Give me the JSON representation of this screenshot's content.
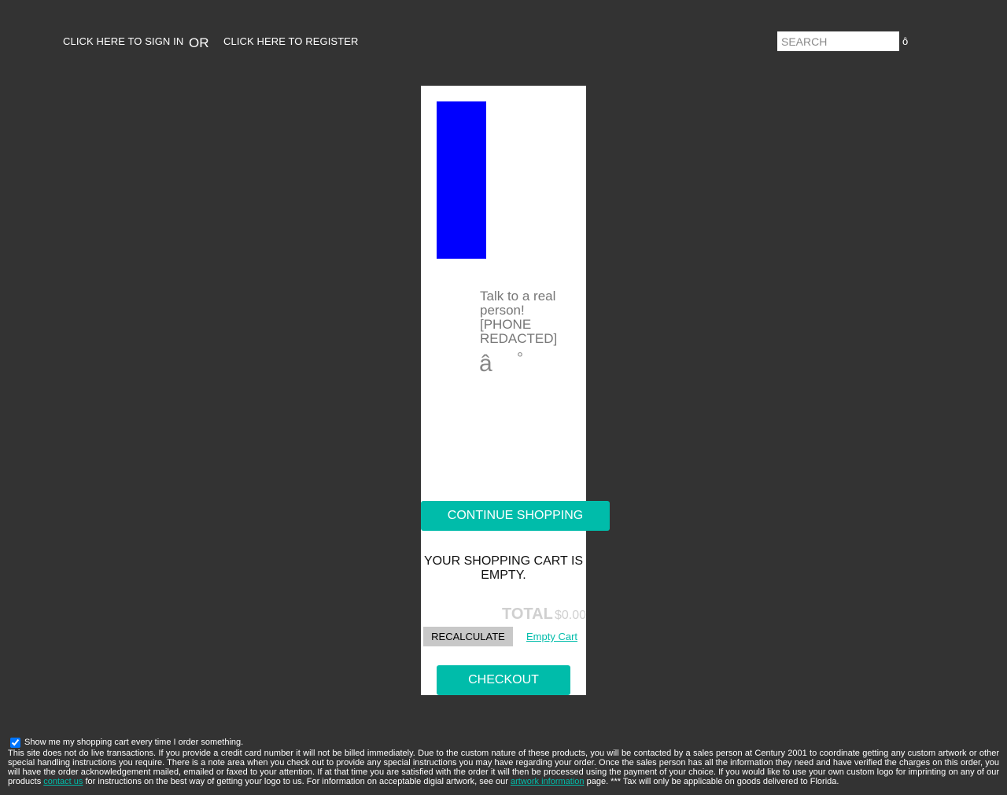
{
  "header": {
    "signin_label": "CLICK HERE TO SIGN IN",
    "or_label": "OR",
    "register_label": "CLICK HERE TO REGISTER",
    "search_placeholder": "SEARCH",
    "search_icon_glyph": "ȏ"
  },
  "cart": {
    "talk_text": "Talk to a real person! [PHONE REDACTED]",
    "glyph_a": "â",
    "glyph_degree": "°",
    "continue_label": "CONTINUE SHOPPING",
    "empty_message": "YOUR SHOPPING CART IS EMPTY.",
    "total_label": "TOTAL",
    "total_value": "$0.00",
    "recalculate_label": "RECALCULATE",
    "empty_cart_label": "Empty Cart",
    "checkout_label": "CHECKOUT"
  },
  "footer": {
    "show_cart_label": "Show me my shopping cart every time I order something.",
    "show_cart_checked": true,
    "notice_part1": "This site does not do live transactions. If you provide a credit card number it will not be billed immediately. Due to the custom nature of these products, you will be contacted by a sales person at Century 2001 to coordinate getting any custom artwork or other special handling instructions you require. There is a note area when you check out to provide any special instructions you may have regarding your order. Once the sales person has all the information they need and have verified the charges on this order, you will have the order acknowledgement mailed, emailed or faxed to your attention. If at that time you are satisfied with the order it will then be processed using the payment of your choice. If you would like to use your own custom logo for imprinting on any of our products",
    "contact_link": "contact us",
    "notice_part2": "for instructions on the best way of getting your logo to us. For information on acceptable digial artwork, see our",
    "artwork_link": "artwork information",
    "notice_part3": "page. *** Tax will only be applicable on goods delivered to Florida."
  },
  "colors": {
    "background": "#333333",
    "accent": "#00bcaa",
    "panel": "#ffffff",
    "blue_box": "#0000ff"
  }
}
